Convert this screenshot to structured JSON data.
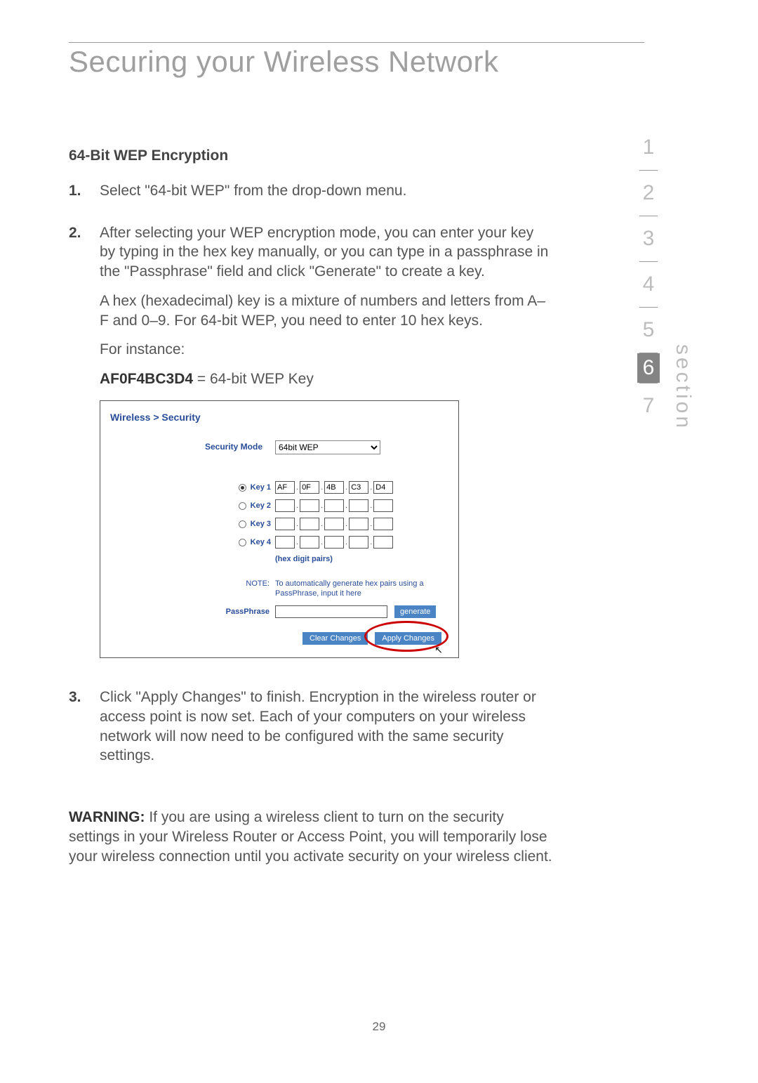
{
  "title": "Securing your Wireless Network",
  "subhead": "64-Bit WEP Encryption",
  "steps": {
    "s1_num": "1.",
    "s1_text": "Select  \"64-bit WEP\" from the drop-down menu.",
    "s2_num": "2.",
    "s2_p1": "After selecting your WEP encryption mode, you can enter your key by typing in the hex key manually, or you can type in a passphrase in the \"Passphrase\" field and click \"Generate\" to create a key.",
    "s2_p2": "A hex (hexadecimal) key is a mixture of numbers and letters from A–F and 0–9. For 64-bit WEP, you need to enter 10 hex keys.",
    "s2_p3": "For instance:",
    "s2_example_bold": "AF0F4BC3D4",
    "s2_example_rest": " = 64-bit WEP Key",
    "s3_num": "3.",
    "s3_text": "Click \"Apply Changes\" to finish. Encryption in the wireless router or access point is now set. Each of your computers on your wireless network will now need to be configured with the same security settings."
  },
  "router": {
    "breadcrumb": "Wireless > Security",
    "sec_mode_label": "Security Mode",
    "sec_mode_value": "64bit WEP",
    "keys": [
      {
        "label": "Key 1",
        "selected": true,
        "vals": [
          "AF",
          "0F",
          "4B",
          "C3",
          "D4"
        ]
      },
      {
        "label": "Key 2",
        "selected": false,
        "vals": [
          "",
          "",
          "",
          "",
          ""
        ]
      },
      {
        "label": "Key 3",
        "selected": false,
        "vals": [
          "",
          "",
          "",
          "",
          ""
        ]
      },
      {
        "label": "Key 4",
        "selected": false,
        "vals": [
          "",
          "",
          "",
          "",
          ""
        ]
      }
    ],
    "hex_note": "(hex digit pairs)",
    "note_label": "NOTE:",
    "note_text": "To automatically generate hex pairs using a PassPhrase, input it here",
    "pass_label": "PassPhrase",
    "generate": "generate",
    "clear": "Clear Changes",
    "apply": "Apply Changes"
  },
  "warning_label": "WARNING:",
  "warning_text": " If you are using a wireless client to turn on the security settings in your Wireless Router or Access Point, you will temporarily lose your wireless connection until you activate security on your wireless client.",
  "page_number": "29",
  "nav": [
    "1",
    "2",
    "3",
    "4",
    "5",
    "6",
    "7"
  ],
  "nav_active": "6",
  "section_label": "section"
}
